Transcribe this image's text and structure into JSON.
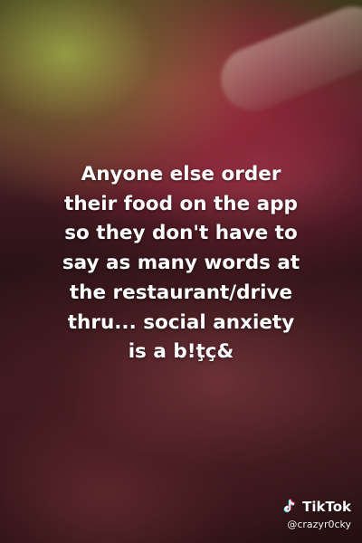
{
  "caption": {
    "text": "Anyone else order\ntheir food on the app\nso they don't have to\nsay as many words at\nthe restaurant/drive\nthru... social anxiety\nis a b!ţç&"
  },
  "watermark": {
    "brand": "TikTok",
    "handle": "@crazyr0cky",
    "logo_icon": "tiktok-note-icon"
  }
}
